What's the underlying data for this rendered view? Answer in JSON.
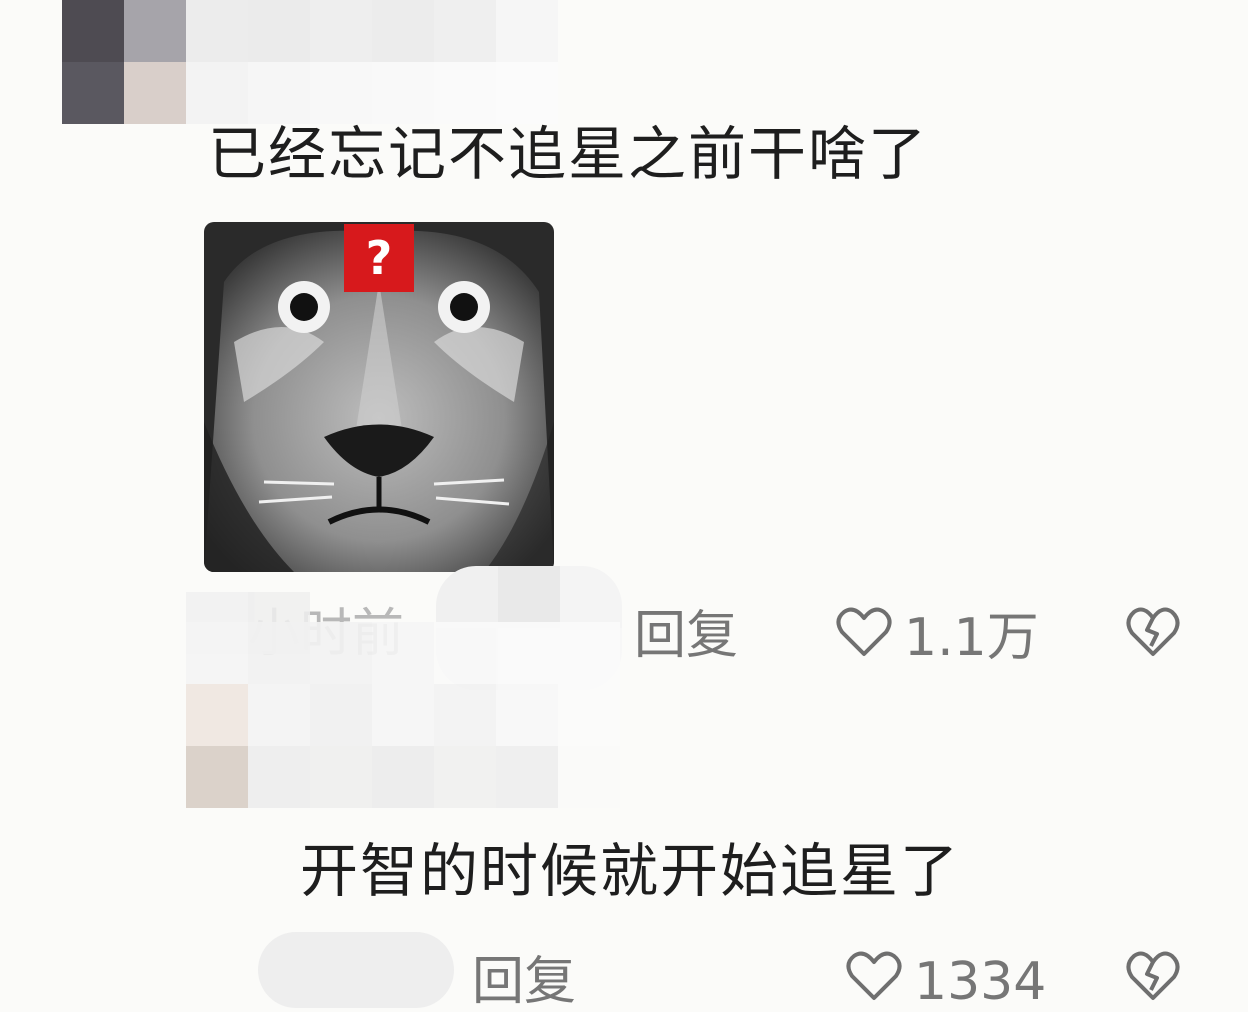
{
  "comment1": {
    "text": "已经忘记不追星之前干啥了",
    "time_partial": "小时前",
    "reply_label": "回复",
    "likes": "1.1万",
    "sticker_badge": "?"
  },
  "comment2": {
    "text": "开智的时候就开始追星了",
    "reply_label": "回复",
    "likes": "1334"
  },
  "icons": {
    "like": "heart-outline-icon",
    "dislike": "broken-heart-icon"
  },
  "colors": {
    "background": "#fbfbf9",
    "meta_text": "#767676",
    "badge_red": "#d7191c"
  }
}
